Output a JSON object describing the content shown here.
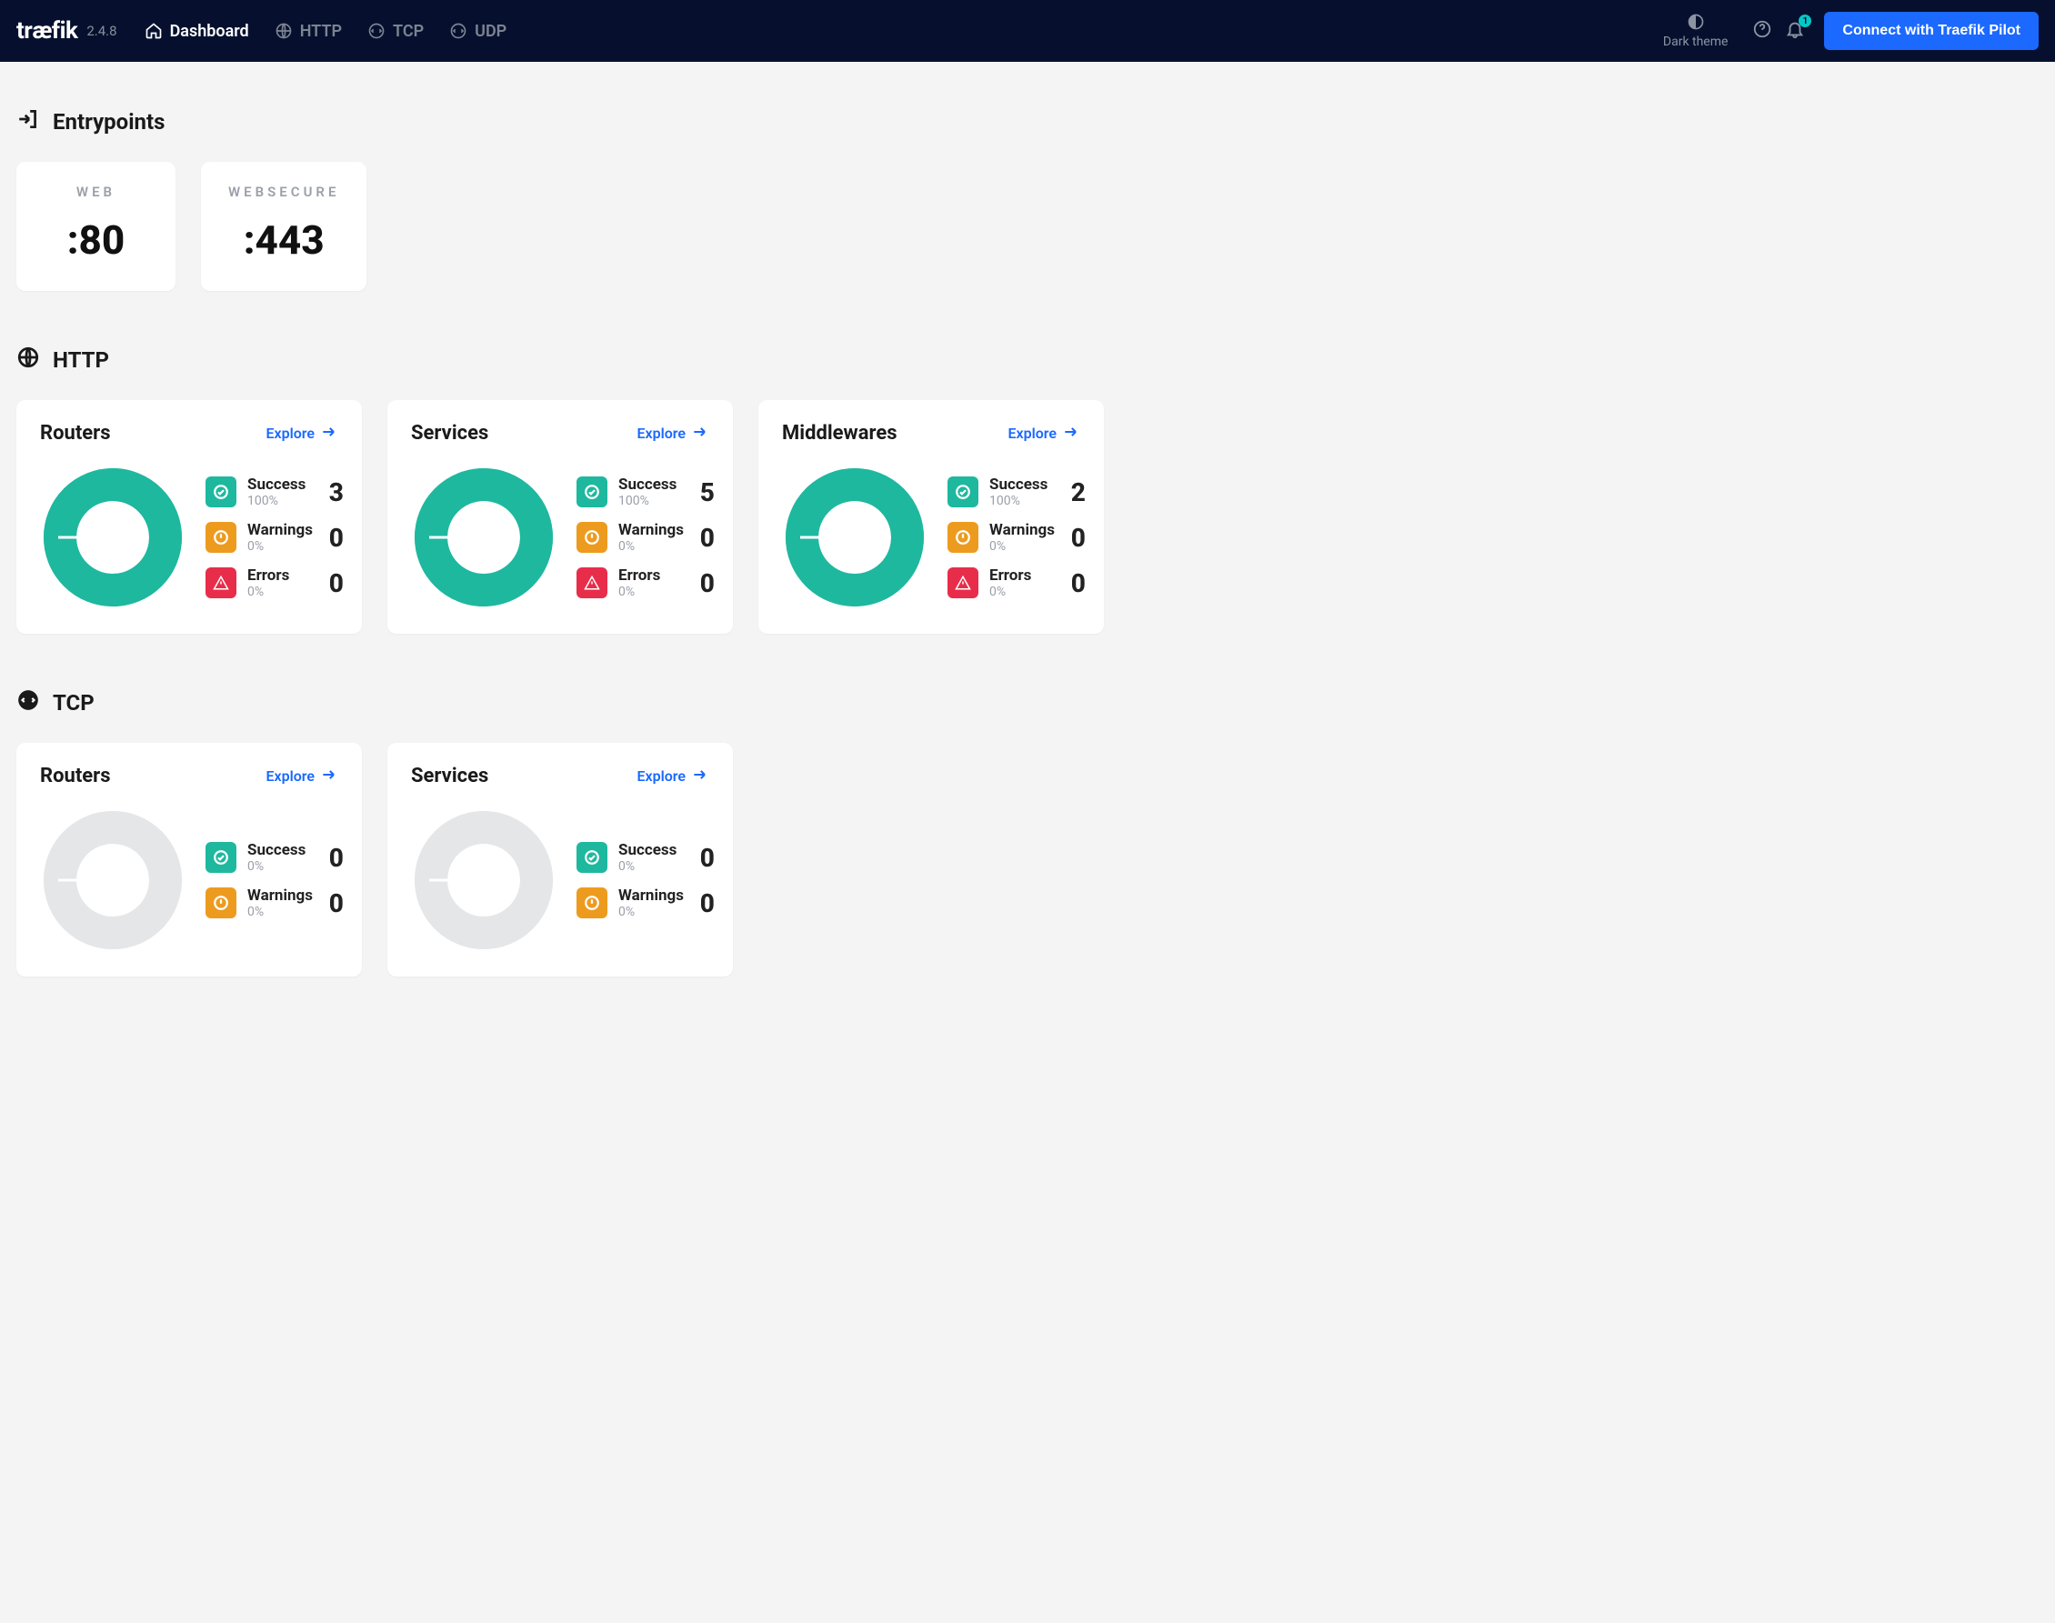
{
  "header": {
    "logo": "træfik",
    "version": "2.4.8",
    "nav": [
      {
        "id": "dashboard",
        "label": "Dashboard",
        "active": true
      },
      {
        "id": "http",
        "label": "HTTP",
        "active": false
      },
      {
        "id": "tcp",
        "label": "TCP",
        "active": false
      },
      {
        "id": "udp",
        "label": "UDP",
        "active": false
      }
    ],
    "theme_label": "Dark theme",
    "notifications_badge": "1",
    "connect_label": "Connect with Traefik Pilot"
  },
  "sections": {
    "entrypoints": {
      "title": "Entrypoints",
      "items": [
        {
          "name": "WEB",
          "port": ":80"
        },
        {
          "name": "WEBSECURE",
          "port": ":443"
        }
      ]
    },
    "http": {
      "title": "HTTP",
      "cards": [
        {
          "title": "Routers",
          "explore": "Explore",
          "success": {
            "label": "Success",
            "pct": "100%",
            "count": "3"
          },
          "warnings": {
            "label": "Warnings",
            "pct": "0%",
            "count": "0"
          },
          "errors": {
            "label": "Errors",
            "pct": "0%",
            "count": "0"
          },
          "donut_pct": 100
        },
        {
          "title": "Services",
          "explore": "Explore",
          "success": {
            "label": "Success",
            "pct": "100%",
            "count": "5"
          },
          "warnings": {
            "label": "Warnings",
            "pct": "0%",
            "count": "0"
          },
          "errors": {
            "label": "Errors",
            "pct": "0%",
            "count": "0"
          },
          "donut_pct": 100
        },
        {
          "title": "Middlewares",
          "explore": "Explore",
          "success": {
            "label": "Success",
            "pct": "100%",
            "count": "2"
          },
          "warnings": {
            "label": "Warnings",
            "pct": "0%",
            "count": "0"
          },
          "errors": {
            "label": "Errors",
            "pct": "0%",
            "count": "0"
          },
          "donut_pct": 100
        }
      ]
    },
    "tcp": {
      "title": "TCP",
      "cards": [
        {
          "title": "Routers",
          "explore": "Explore",
          "success": {
            "label": "Success",
            "pct": "0%",
            "count": "0"
          },
          "warnings": {
            "label": "Warnings",
            "pct": "0%",
            "count": "0"
          },
          "donut_pct": 0
        },
        {
          "title": "Services",
          "explore": "Explore",
          "success": {
            "label": "Success",
            "pct": "0%",
            "count": "0"
          },
          "warnings": {
            "label": "Warnings",
            "pct": "0%",
            "count": "0"
          },
          "donut_pct": 0
        }
      ]
    }
  },
  "colors": {
    "teal": "#1eb89f",
    "orange": "#ed9b1f",
    "red": "#e82d4b",
    "blue": "#1b69ff",
    "grey": "#e5e6e8"
  }
}
